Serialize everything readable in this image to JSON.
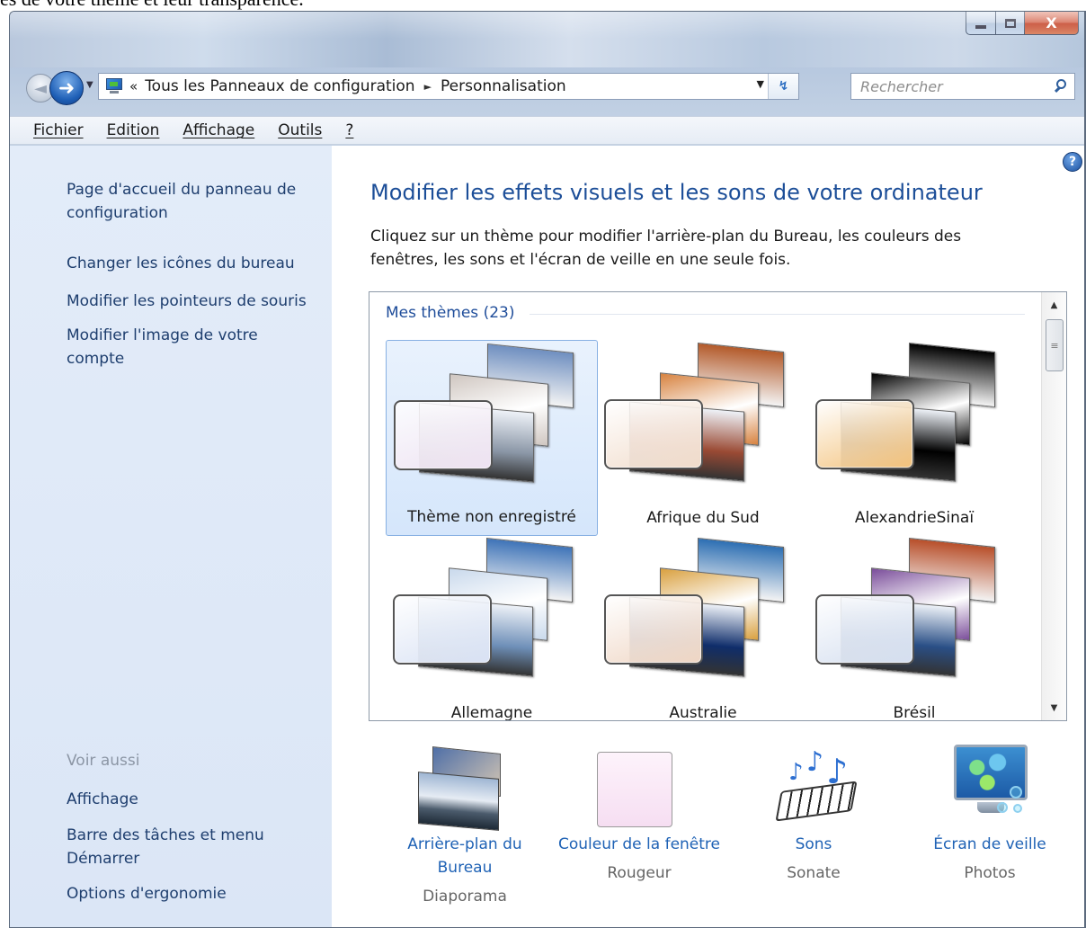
{
  "document_text": "es de votre thème et leur transparence.",
  "window": {
    "min_label": "",
    "max_label": "",
    "close_label": "X"
  },
  "address": {
    "crumbs": [
      "Tous les Panneaux de configuration",
      "Personnalisation"
    ],
    "chevron": "«",
    "separator": "►"
  },
  "search": {
    "placeholder": "Rechercher"
  },
  "menu": [
    "Fichier",
    "Edition",
    "Affichage",
    "Outils",
    "?"
  ],
  "sidebar": {
    "links": [
      "Page d'accueil du panneau de configuration",
      "Changer les icônes du bureau",
      "Modifier les pointeurs de souris",
      "Modifier l'image de votre compte"
    ],
    "see_also_label": "Voir aussi",
    "see_also": [
      "Affichage",
      "Barre des tâches et menu Démarrer",
      "Options d'ergonomie"
    ]
  },
  "main": {
    "title": "Modifier les effets visuels et les sons de votre ordinateur",
    "intro": "Cliquez sur un thème pour modifier l'arrière-plan du Bureau, les couleurs des fenêtres, les sons et l'écran de veille en une seule fois.",
    "group_label": "Mes thèmes (23)",
    "themes": [
      {
        "name": "Thème non enregistré",
        "selected": true,
        "card_color": "#efe3f2",
        "photos": [
          "#6f8fc0",
          "#cfc6c0",
          "#8a96a6"
        ]
      },
      {
        "name": "Afrique du Sud",
        "selected": false,
        "card_color": "#f1dccb",
        "photos": [
          "#b35a2a",
          "#d7823f",
          "#9a4a34"
        ]
      },
      {
        "name": "AlexandrieSinaï",
        "selected": false,
        "card_color": "#f3c27b",
        "photos": [
          "#000000",
          "#000000",
          "#000000"
        ]
      },
      {
        "name": "Allemagne",
        "selected": false,
        "card_color": "#d9e2f4",
        "photos": [
          "#3f74b8",
          "#c9d9ec",
          "#6e8fb8"
        ]
      },
      {
        "name": "Australie",
        "selected": false,
        "card_color": "#efd6c4",
        "photos": [
          "#2d6fb3",
          "#d9a03f",
          "#0f2d6a"
        ]
      },
      {
        "name": "Brésil",
        "selected": false,
        "card_color": "#d5dff0",
        "photos": [
          "#b84f2a",
          "#7a4d9a",
          "#2a4f86"
        ]
      }
    ]
  },
  "actions": [
    {
      "title": "Arrière-plan du Bureau",
      "sub": "Diaporama"
    },
    {
      "title": "Couleur de la fenêtre",
      "sub": "Rougeur"
    },
    {
      "title": "Sons",
      "sub": "Sonate"
    },
    {
      "title": "Écran de veille",
      "sub": "Photos"
    }
  ],
  "colors": {
    "link": "#1f62b5",
    "title": "#1c4e98",
    "sidebar_link": "#1e3e6e",
    "selection": "#d5e6fb"
  }
}
